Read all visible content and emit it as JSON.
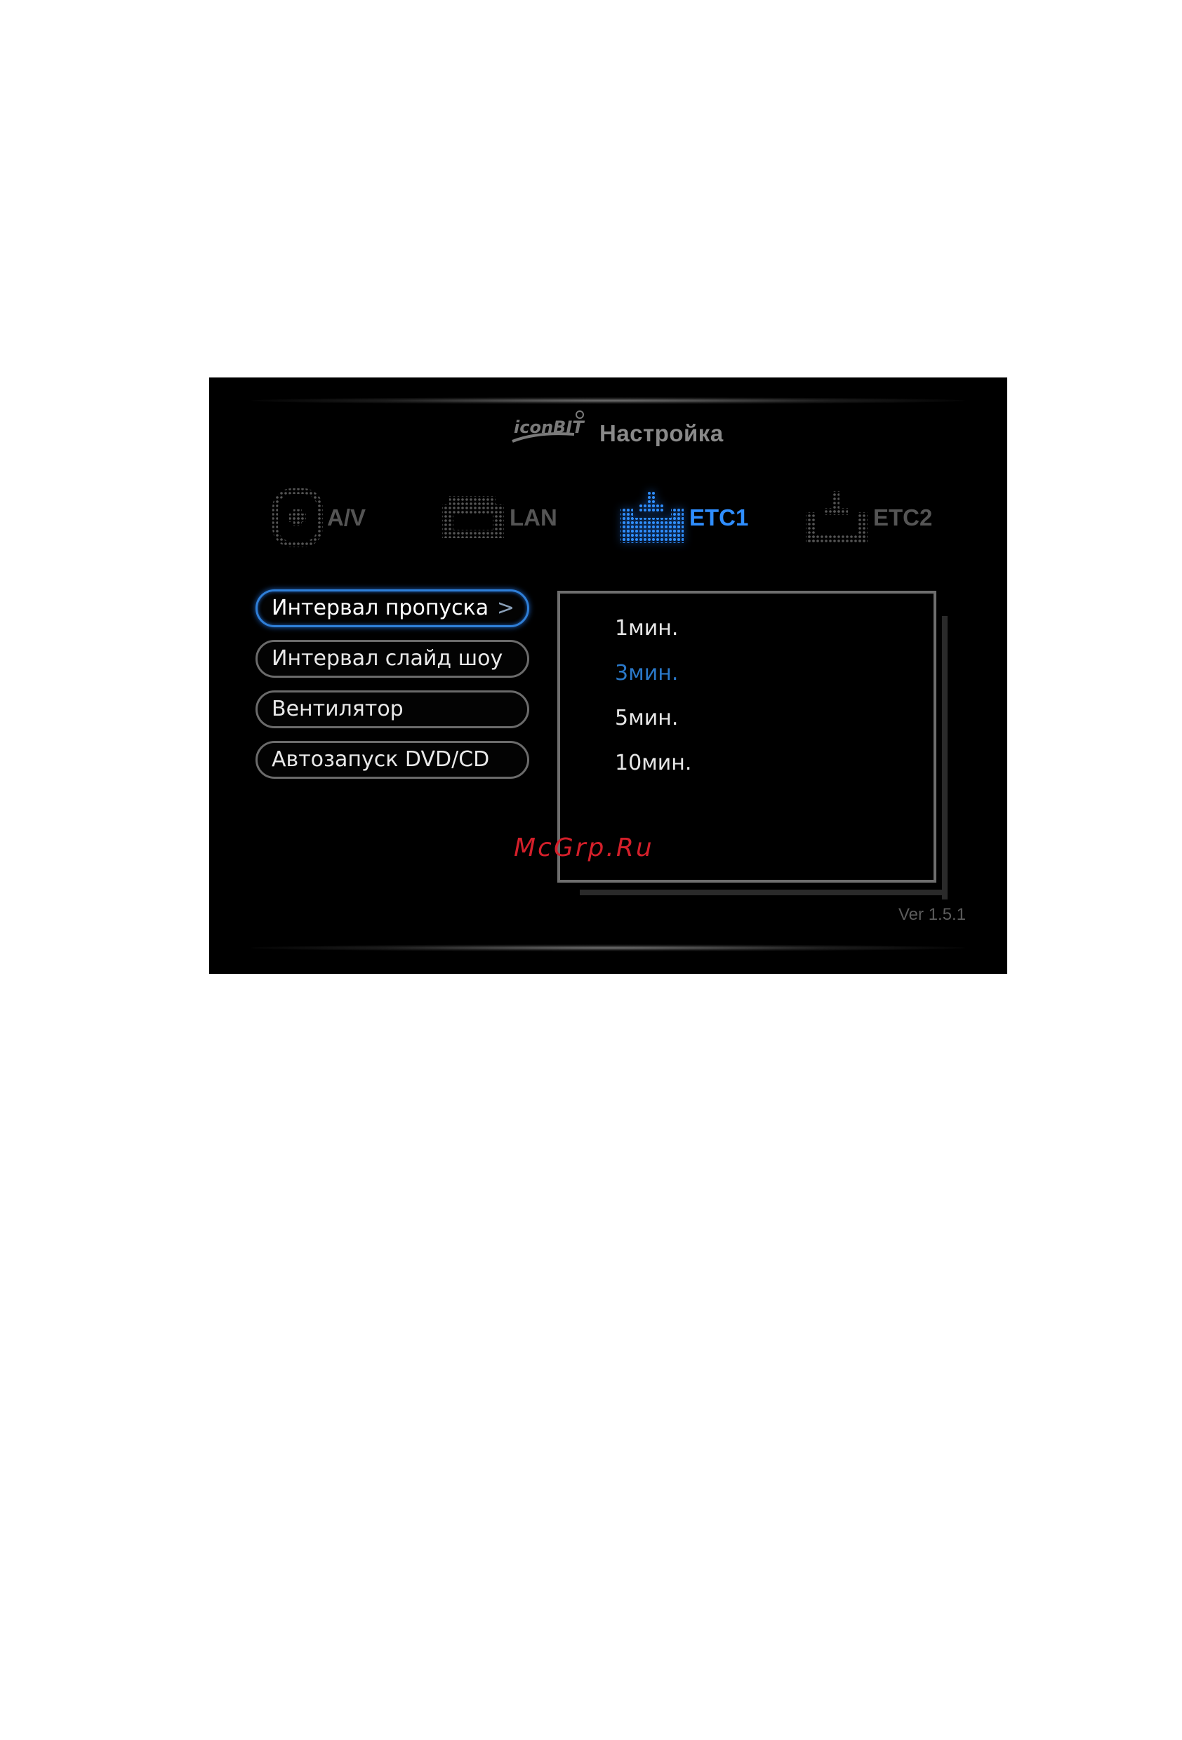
{
  "header": {
    "brand_logo": "iconBIT",
    "title": "Настройка"
  },
  "tabs": [
    {
      "label": "A/V",
      "icon": "av-dots-icon",
      "active": false
    },
    {
      "label": "LAN",
      "icon": "lan-dots-icon",
      "active": false
    },
    {
      "label": "ETC1",
      "icon": "etc-dots-icon",
      "active": true
    },
    {
      "label": "ETC2",
      "icon": "etc-dots-icon",
      "active": false
    }
  ],
  "menu": {
    "items": [
      {
        "label": "Интервал пропуска",
        "selected": true
      },
      {
        "label": "Интервал слайд шоу",
        "selected": false
      },
      {
        "label": "Вентилятор",
        "selected": false
      },
      {
        "label": "Автозапуск DVD/CD",
        "selected": false
      }
    ],
    "chevron": ">"
  },
  "options": {
    "items": [
      {
        "label": "1мин.",
        "selected": false
      },
      {
        "label": "3мин.",
        "selected": true
      },
      {
        "label": "5мин.",
        "selected": false
      },
      {
        "label": "10мин.",
        "selected": false
      }
    ]
  },
  "watermark": "McGrp.Ru",
  "version": "Ver 1.5.1",
  "colors": {
    "accent": "#2f8eff",
    "inactive": "#555555",
    "background": "#000000",
    "watermark": "#d41f2a"
  }
}
